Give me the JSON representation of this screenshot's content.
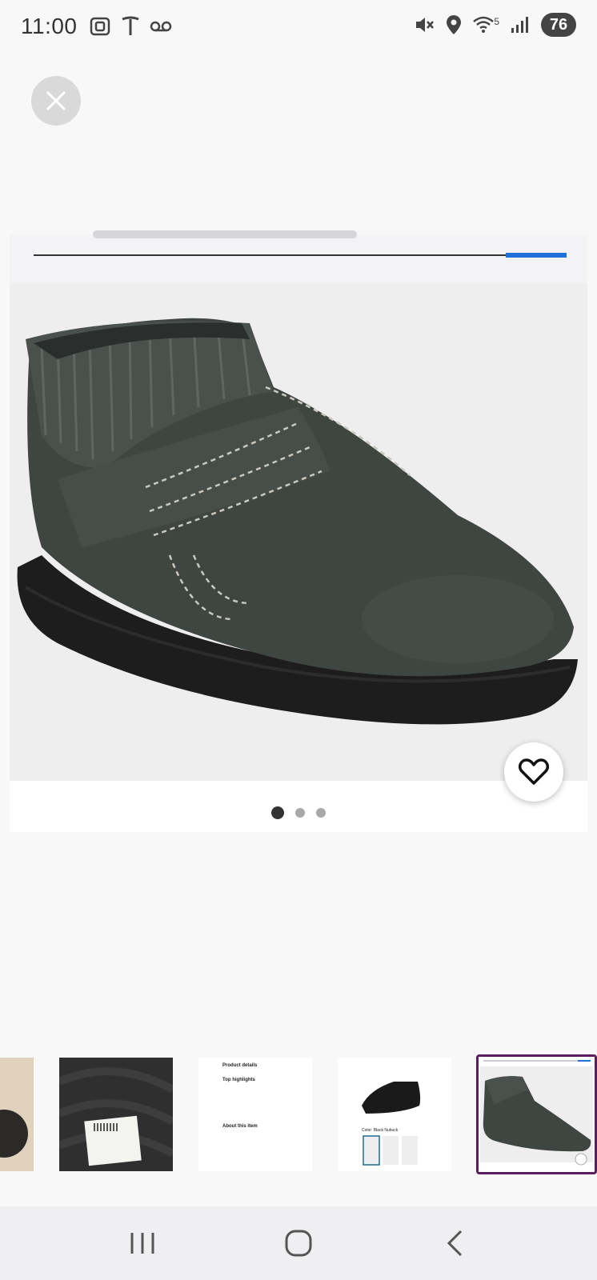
{
  "status": {
    "time": "11:00",
    "battery": "76",
    "left_icons": [
      "screen-record-icon",
      "tesla-icon",
      "voicemail-icon"
    ],
    "right_icons": [
      "mute-icon",
      "location-icon",
      "wifi-icon",
      "signal-icon"
    ],
    "wifi_label": "5"
  },
  "viewer": {
    "image_alt": "Dark gray ankle boot with knit collar and strap",
    "page_count": 3,
    "active_page": 1
  },
  "thumbnails": [
    {
      "name": "thumb-1",
      "label": ""
    },
    {
      "name": "thumb-2",
      "label": ""
    },
    {
      "name": "thumb-3",
      "title": "Product details",
      "heading": "Top highlights",
      "about": "About this item"
    },
    {
      "name": "thumb-4",
      "color_label": "Color: Black Nubuck"
    },
    {
      "name": "thumb-5",
      "label": ""
    }
  ],
  "colors": {
    "accent_blue": "#1f72d8",
    "selected_border": "#5b1d5f",
    "boot": "#3f4541"
  }
}
